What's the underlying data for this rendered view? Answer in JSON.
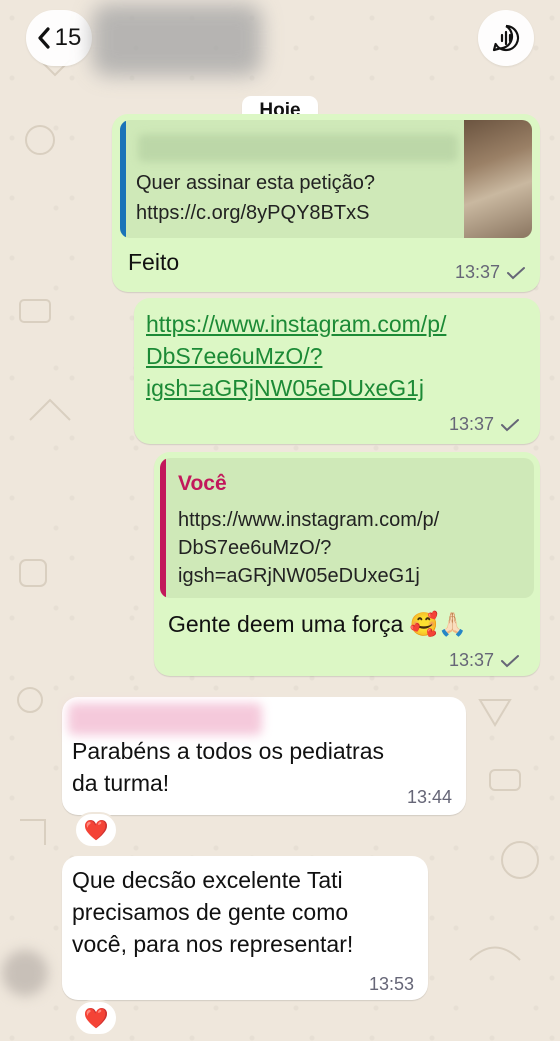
{
  "header": {
    "back_count": "15",
    "back_icon": "chevron-left-icon",
    "call_icon": "voice-chat-icon"
  },
  "date_separator": "Hoje",
  "messages": [
    {
      "quote_text_1": "Quer assinar esta petição?",
      "quote_text_2": "https://c.org/8yPQY8BTxS",
      "text": "Feito",
      "time": "13:37"
    },
    {
      "link_1": "https://www.instagram.com/p/",
      "link_2": "DbS7ee6uMzO/?",
      "link_3": "igsh=aGRjNW05eDUxeG1j",
      "time": "13:37"
    },
    {
      "quote_author": "Você",
      "quote_line_1": "https://www.instagram.com/p/",
      "quote_line_2": "DbS7ee6uMzO/?",
      "quote_line_3": "igsh=aGRjNW05eDUxeG1j",
      "text": "Gente deem uma força 🥰🙏🏻",
      "time": "13:37"
    },
    {
      "line_1": "Parabéns a todos os pediatras",
      "line_2": "da turma!",
      "time": "13:44",
      "reaction": "❤️"
    },
    {
      "line_1": "Que decsão excelente Tati",
      "line_2": "precisamos de gente como",
      "line_3": "você, para nos representar!",
      "time": "13:53",
      "reaction": "❤️"
    }
  ],
  "colors": {
    "outgoing_bubble": "#dcf7c5",
    "incoming_bubble": "#ffffff",
    "link": "#1c8a36",
    "quote_bar_link": "#1a73b8",
    "quote_bar_self": "#c2185b",
    "author_self": "#c2185b",
    "wallpaper": "#efe7dc"
  }
}
